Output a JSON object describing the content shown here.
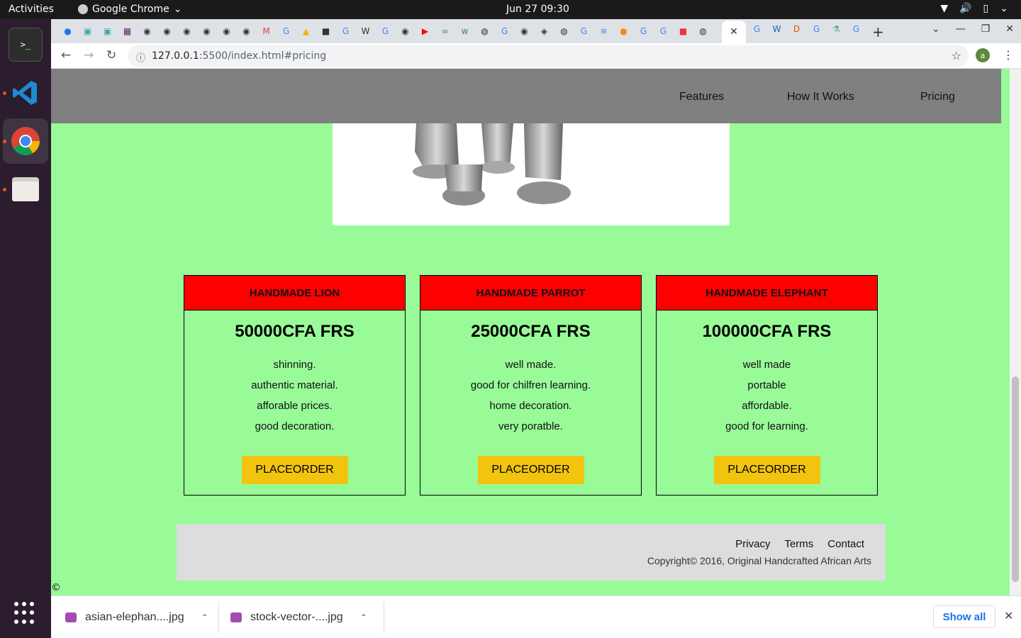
{
  "system": {
    "activities": "Activities",
    "app_name": "Google Chrome",
    "clock": "Jun 27  09:30"
  },
  "browser": {
    "url_host": "127.0.0.1",
    "url_path": ":5500/index.html#pricing",
    "profile_initial": "a",
    "tab_close": "✕",
    "new_tab": "+"
  },
  "site": {
    "nav": [
      "Features",
      "How It Works",
      "Pricing"
    ],
    "cards": [
      {
        "title": "HANDMADE LION",
        "price": "50000CFA FRS",
        "features": [
          "shinning.",
          "authentic material.",
          "afforable prices.",
          "good decoration."
        ],
        "button": "PLACEORDER"
      },
      {
        "title": "HANDMADE PARROT",
        "price": "25000CFA FRS",
        "features": [
          "well made.",
          "good for chilfren learning.",
          "home decoration.",
          "very poratble."
        ],
        "button": "PLACEORDER"
      },
      {
        "title": "HANDMADE ELEPHANT",
        "price": "100000CFA FRS",
        "features": [
          "well made",
          "portable",
          "affordable.",
          "good for learning."
        ],
        "button": "PLACEORDER"
      }
    ],
    "footer": {
      "links": [
        "Privacy",
        "Terms",
        "Contact"
      ],
      "copyright": "Copyright© 2016, Original Handcrafted African Arts"
    },
    "stray_text": "©"
  },
  "downloads": {
    "items": [
      "asian-elephan....jpg",
      "stock-vector-....jpg"
    ],
    "show_all": "Show all"
  },
  "colors": {
    "page_bg": "#98fb98",
    "nav_bg": "#808080",
    "card_header": "#ff0000",
    "button": "#f1c40f",
    "footer_bg": "#dddddd"
  }
}
